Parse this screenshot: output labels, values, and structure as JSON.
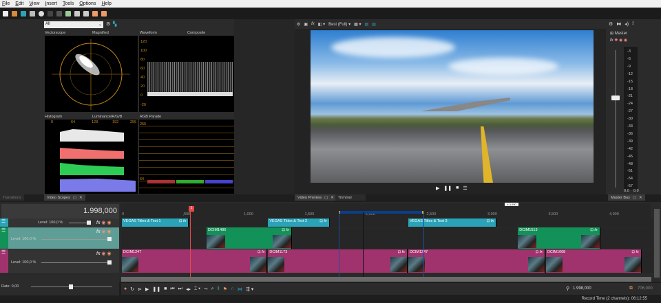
{
  "menu": [
    "File",
    "Edit",
    "View",
    "Insert",
    "Tools",
    "Options",
    "Help"
  ],
  "scopes": {
    "filter_value": "All",
    "vectorscope": "Vectorscope",
    "vectorscope_mode": "Magnified",
    "waveform": "Waveform",
    "waveform_mode": "Composite",
    "waveform_scale": [
      "120",
      "100",
      "80",
      "60",
      "40",
      "20",
      "0",
      "-20"
    ],
    "histogram": "Histogram",
    "histogram_mode": "Luminance/R/G/B",
    "histogram_scale": [
      "0",
      "64",
      "128",
      "192",
      "255"
    ],
    "rgb_parade": "RGB Parade",
    "parade_scale": [
      "255",
      "64"
    ]
  },
  "tabs": {
    "transitions": "Transitions",
    "video_scopes": "Video Scopes",
    "video_preview": "Video Preview",
    "trimmer": "Trimmer",
    "master_bus": "Master Bus"
  },
  "preview": {
    "quality": "Best (Full)"
  },
  "master": {
    "label": "Master",
    "scale": [
      "-3",
      "-6",
      "-9",
      "-12",
      "-15",
      "-18",
      "-21",
      "-24",
      "-27",
      "-30",
      "-33",
      "-36",
      "-39",
      "-42",
      "-45",
      "-48",
      "-51",
      "-54",
      "-57"
    ],
    "left_value": "0.0",
    "right_value": "0.0"
  },
  "timeline": {
    "time": "1.998,000",
    "ruler": [
      "0",
      ",500",
      "1,000",
      "1,500",
      "2,000",
      "2,500",
      "3,000",
      "3,500",
      "4,000"
    ],
    "marker": "1",
    "loop_length": "4,3,000",
    "tracks": [
      {
        "level": "Level: 100,0 %",
        "color": "#2aa3b8",
        "clips": [
          {
            "label": "VEGAS Titles & Text 1",
            "start": 0,
            "end": 555
          },
          {
            "label": "VEGAS Titles & Text 2",
            "start": 1200,
            "end": 1710
          },
          {
            "label": "VEGAS Titles & Text 3",
            "start": 2350,
            "end": 3080
          }
        ]
      },
      {
        "level": "Level: 100,0 %",
        "color": "#129259",
        "clips": [
          {
            "label": "DCIM1486",
            "start": 695,
            "end": 1400
          },
          {
            "label": "DCIM1513",
            "start": 3250,
            "end": 3930
          }
        ]
      },
      {
        "level": "Level: 100,0 %",
        "color": "#a0336e",
        "clips": [
          {
            "label": "DCIM1247",
            "start": 0,
            "end": 1200
          },
          {
            "label": "DCIM1173",
            "start": 1200,
            "end": 2350
          },
          {
            "label": "DCIM1247",
            "start": 2350,
            "end": 3480
          },
          {
            "label": "DCIM1068",
            "start": 3480,
            "end": 4270
          }
        ]
      }
    ]
  },
  "transport": {
    "rate": "Rate: 0,00",
    "cursor_time": "1.998,000",
    "selection_length": "706,000"
  },
  "status": {
    "record_time": "Record Time (2 channels): 06:12:55"
  },
  "colors": {
    "title_track": "#2aa3b8",
    "video_track": "#129259",
    "audio_track": "#a0336e",
    "scope_grid": "#c88a1a"
  }
}
